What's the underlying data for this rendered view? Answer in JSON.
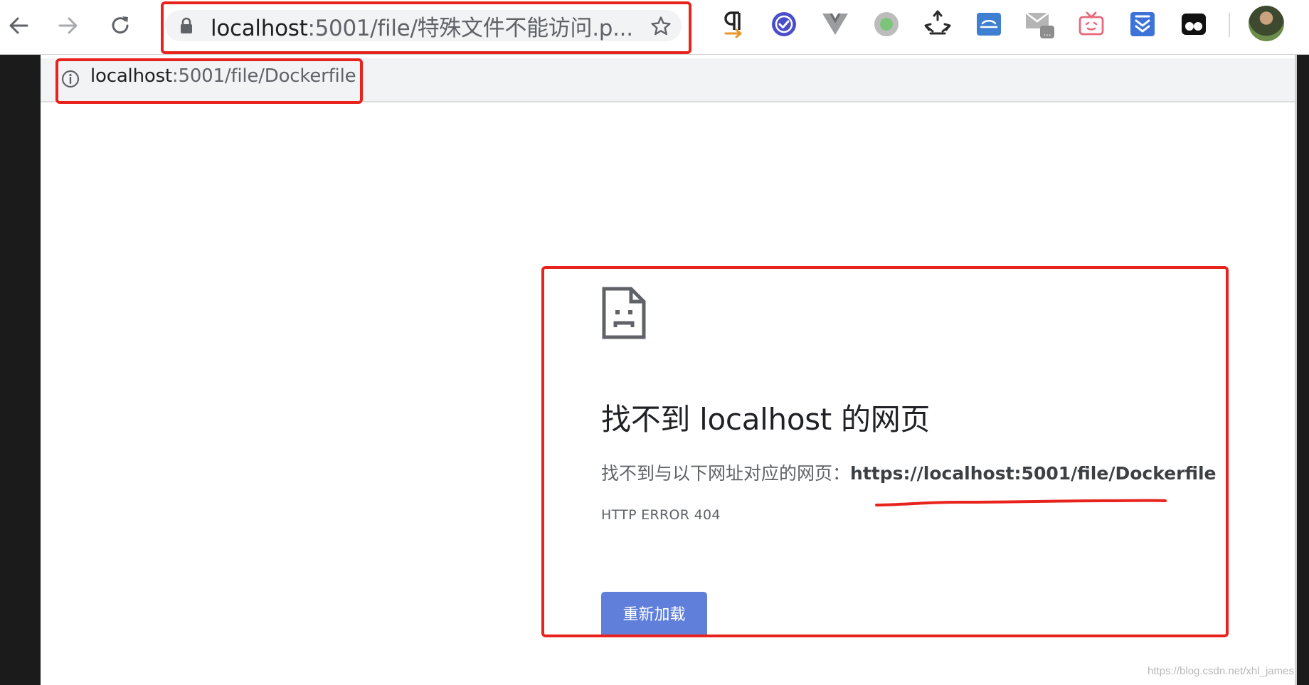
{
  "toolbar": {
    "address": {
      "host": "localhost",
      "path": ":5001/file/特殊文件不能访问.p..."
    },
    "extensions": [
      "paragraph-icon",
      "checkmark-badge-icon",
      "vue-v-icon",
      "green-dot-icon",
      "recycle-icon",
      "drive-icon",
      "mail-icon",
      "tv-icon",
      "download-box-icon",
      "glasses-icon"
    ]
  },
  "inner_bar": {
    "host": "localhost",
    "path": ":5001/file/Dockerfile"
  },
  "error_page": {
    "title": "找不到 localhost 的网页",
    "desc_label": "找不到与以下网址对应的网页：",
    "desc_url": "https://localhost:5001/file/Dockerfile",
    "code": "HTTP ERROR 404",
    "reload_label": "重新加载"
  },
  "watermark": "https://blog.csdn.net/xhl_james",
  "colors": {
    "highlight": "#e8231d",
    "reload_button": "#5f7fdb",
    "accent_blue": "#4a6cd4"
  }
}
